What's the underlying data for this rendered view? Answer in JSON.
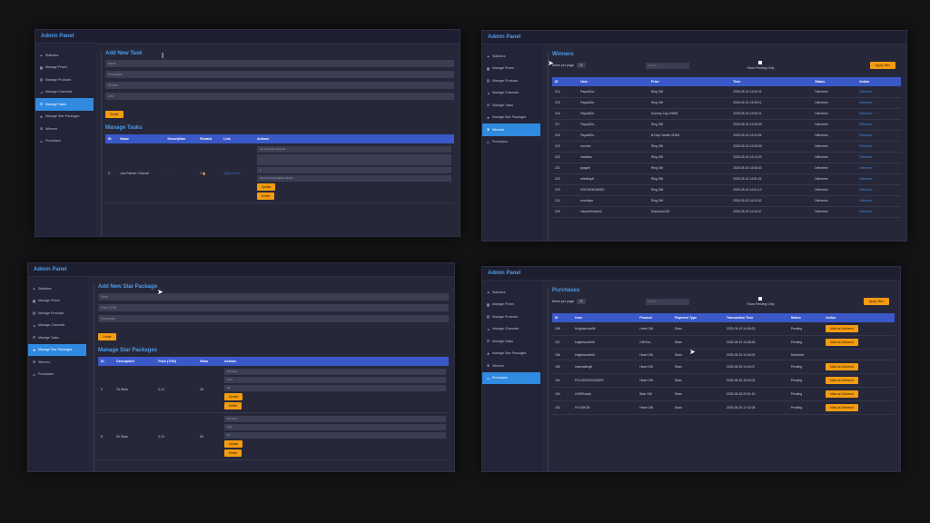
{
  "app_title": "Admin Panel",
  "nav": [
    "Statistics",
    "Manage Prizes",
    "Manage Products",
    "Manage Channels",
    "Manage Tasks",
    "Manage Star Packages",
    "Winners",
    "Purchases"
  ],
  "nav_icons": [
    "chart-icon",
    "prize-icon",
    "product-icon",
    "channel-icon",
    "tasks-icon",
    "star-icon",
    "trophy-icon",
    "cart-icon"
  ],
  "tasks": {
    "add_title": "Add New Task",
    "fields": [
      "Name",
      "Description",
      "Reward",
      "Link"
    ],
    "create_label": "Create",
    "manage_title": "Manage Tasks",
    "headers": [
      "ID",
      "Name",
      "Description",
      "Reward",
      "Link",
      "Actions"
    ],
    "row": {
      "id": "6",
      "name": "Join Partner Channel",
      "description": "-",
      "reward": "1 🔥",
      "link": "https://t.me/..."
    },
    "actions": [
      "Join Partner Channel",
      "",
      "1",
      "https://t.me/Knightscode/26",
      "Update",
      "Delete"
    ]
  },
  "winners": {
    "title": "Winners",
    "items_label": "Items per page",
    "items_value": "25",
    "search_placeholder": "Search...",
    "pending_label": "Show Pending Only",
    "apply_label": "Apply Filter",
    "headers": [
      "ID",
      "User",
      "Prize",
      "Time",
      "Status",
      "Action"
    ],
    "rows": [
      [
        "214",
        "PapaAiDu",
        "Ring Gift",
        "2025-05-15 13:02:41",
        "Delivered",
        "Delivered"
      ],
      [
        "215",
        "PapaAiDu",
        "Ring Gift",
        "2025-05-15 13:05:11",
        "Delivered",
        "Delivered"
      ],
      [
        "216",
        "PapaAiDu",
        "Gummy Cap #3595",
        "2025-05-15 13:06:21",
        "Delivered",
        "Delivered"
      ],
      [
        "217",
        "PapaAiDu",
        "Ring Gift",
        "2025-05-15 13:40:09",
        "Delivered",
        "Delivered"
      ],
      [
        "218",
        "PapaAiDu",
        "B-Day Candle #1961",
        "2025-05-15 13:42:54",
        "Delivered",
        "Delivered"
      ],
      [
        "219",
        "ronndor",
        "Ring Gift",
        "2025-05-15 13:53:05",
        "Delivered",
        "Delivered"
      ],
      [
        "220",
        "maxtahu",
        "Ring Gift",
        "2025-05-15 14:14:29",
        "Delivered",
        "Delivered"
      ],
      [
        "221",
        "gasgrill",
        "Ring Gift",
        "2025-05-15 14:56:33",
        "Delivered",
        "Delivered"
      ],
      [
        "222",
        "edesBupll",
        "Ring Gift",
        "2025-05-15 14:51:34",
        "Delivered",
        "Delivered"
      ],
      [
        "223",
        "HOGGENOWSKI",
        "Ring Gift",
        "2025-05-15 14:21:12",
        "Delivered",
        "Delivered"
      ],
      [
        "224",
        "enerdiyer",
        "Ring Gift",
        "2025-05-15 14:32:42",
        "Delivered",
        "Delivered"
      ],
      [
        "225",
        "HasseHendrer2",
        "Diamond Gift",
        "2025-05-15 14:34:47",
        "Delivered",
        "Delivered"
      ]
    ]
  },
  "stars": {
    "add_title": "Add New Star Package",
    "fields": [
      "Stars",
      "Price (TON)",
      "Description"
    ],
    "create_label": "Create",
    "manage_title": "Manage Star Packages",
    "headers": [
      "ID",
      "Description",
      "Price (TON)",
      "Stars",
      "Actions"
    ],
    "rows": [
      {
        "id": "9",
        "description": "25 Stars",
        "price": "0.14",
        "stars": "25",
        "actions": [
          "25 Stars",
          "0.14",
          "25"
        ]
      },
      {
        "id": "8",
        "description": "50 Stars",
        "price": "0.24",
        "stars": "50",
        "actions": [
          "50 Stars",
          "0.24",
          "50"
        ]
      }
    ],
    "update_label": "Update",
    "delete_label": "Delete"
  },
  "purchases": {
    "title": "Purchases",
    "items_label": "Items per page",
    "items_value": "25",
    "search_placeholder": "Search...",
    "pending_label": "Show Pending Only",
    "apply_label": "Apply Filter",
    "headers": [
      "ID",
      "User",
      "Product",
      "Payment Type",
      "Transaction Time",
      "Status",
      "Action"
    ],
    "mark_label": "Mark as Delivered",
    "rows": [
      [
        "158",
        "Knightscode06",
        "Heart Gift",
        "Stars",
        "2025-05-19 14:08:33",
        "Pending"
      ],
      [
        "157",
        "knightscode06",
        "Gift Box",
        "Stars",
        "2025-05-19 14:08:26",
        "Pending"
      ],
      [
        "156",
        "knightscode06",
        "Heart Gift",
        "Stars",
        "2025-05-19 14:04:09",
        "Delivered"
      ],
      [
        "155",
        "Usersaiting8",
        "Heart Gift",
        "Stars",
        "2025-05-25 14:40:07",
        "Pending"
      ],
      [
        "154",
        "POLISHORCHASER",
        "Heart Gift",
        "Stars",
        "2025-05-25 15:44:02",
        "Pending"
      ],
      [
        "153",
        "USERhaaki",
        "Bear Gift",
        "Stars",
        "2025-05-26 20:51:15",
        "Pending"
      ],
      [
        "152",
        "FKVSHOB",
        "Heart Gift",
        "Stars",
        "2025-05-26 17:02:08",
        "Pending"
      ]
    ]
  }
}
